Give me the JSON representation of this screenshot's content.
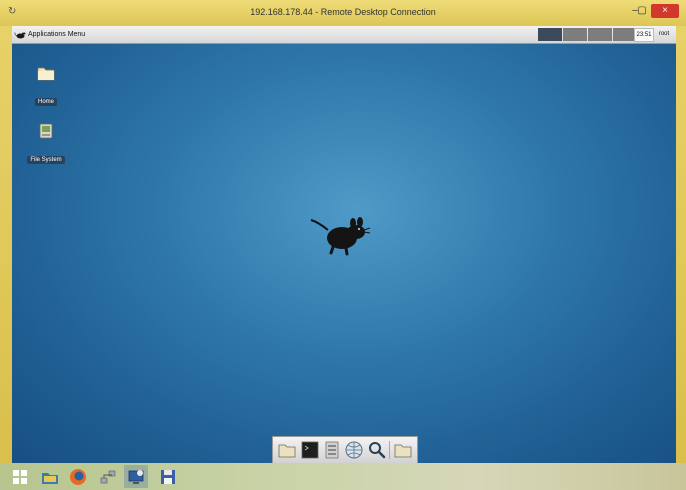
{
  "window": {
    "title": "192.168.178.44 - Remote Desktop Connection",
    "minimize_label": "–",
    "maximize_label": "▢",
    "close_label": "×"
  },
  "panel": {
    "apps_menu_label": "Applications Menu",
    "clock": "23:51",
    "user": "root",
    "workspaces_active_index": 0
  },
  "desktop": {
    "icons": [
      {
        "label": "Home",
        "icon": "folder-icon"
      },
      {
        "label": "File System",
        "icon": "drive-icon"
      }
    ]
  },
  "dock": {
    "items": [
      "folder-icon",
      "terminal-icon",
      "file-manager-icon",
      "web-browser-icon",
      "search-icon",
      "folder-icon"
    ]
  },
  "taskbar": {
    "items": [
      "windows-start-icon",
      "explorer-icon",
      "firefox-icon",
      "network-icon",
      "remote-desktop-icon",
      "save-icon"
    ]
  },
  "colors": {
    "desktop_blue": "#2f78ab",
    "rdp_frame": "#dcc655",
    "close_red": "#d0392b"
  }
}
